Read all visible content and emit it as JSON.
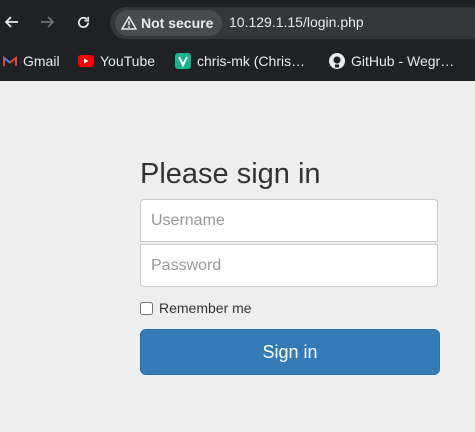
{
  "browser": {
    "security_label": "Not secure",
    "url": "10.129.1.15/login.php",
    "bookmarks": [
      {
        "label": "Gmail",
        "icon": "gmail-icon"
      },
      {
        "label": "YouTube",
        "icon": "youtube-icon"
      },
      {
        "label": "chris-mk (Chris…",
        "icon": "v-icon"
      },
      {
        "label": "GitHub - Wegr…",
        "icon": "github-icon"
      }
    ]
  },
  "login": {
    "title": "Please sign in",
    "username_placeholder": "Username",
    "password_placeholder": "Password",
    "remember_label": "Remember me",
    "submit_label": "Sign in"
  },
  "colors": {
    "primary": "#337ab7",
    "page_bg": "#eeeeee",
    "chrome_bg": "#202124"
  }
}
